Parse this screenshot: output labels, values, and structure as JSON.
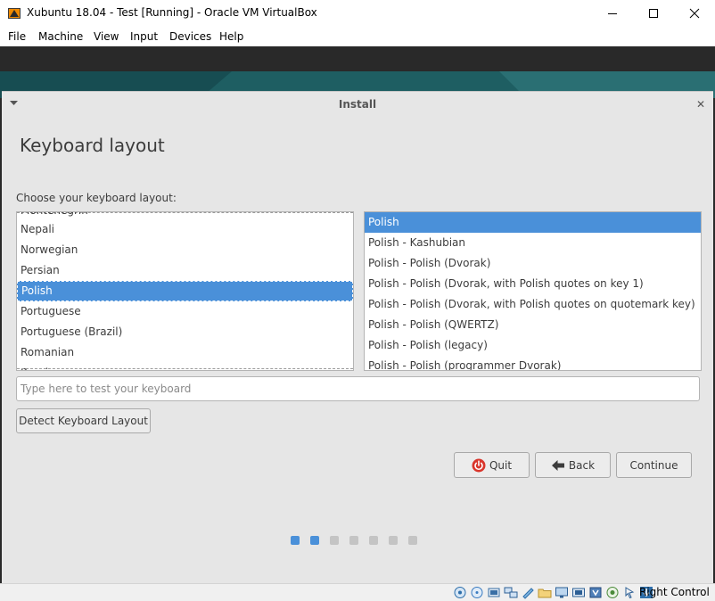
{
  "window": {
    "title": "Xubuntu 18.04 - Test [Running] - Oracle VM VirtualBox",
    "icon": "virtualbox-app-icon",
    "controls": [
      "minimize-icon",
      "maximize-icon",
      "close-icon"
    ]
  },
  "menubar": {
    "items": [
      "File",
      "Machine",
      "View",
      "Input",
      "Devices",
      "Help"
    ]
  },
  "installer": {
    "window_title": "Install",
    "close_glyph": "✕",
    "heading": "Keyboard layout",
    "choose_label": "Choose your keyboard layout:",
    "layouts": [
      "Montenegrin",
      "Nepali",
      "Norwegian",
      "Persian",
      "Polish",
      "Portuguese",
      "Portuguese (Brazil)",
      "Romanian",
      "Russian"
    ],
    "selected_layout": "Polish",
    "variants": [
      "Polish",
      "Polish - Kashubian",
      "Polish - Polish (Dvorak)",
      "Polish - Polish (Dvorak, with Polish quotes on key 1)",
      "Polish - Polish (Dvorak, with Polish quotes on quotemark key)",
      "Polish - Polish (QWERTZ)",
      "Polish - Polish (legacy)",
      "Polish - Polish (programmer Dvorak)"
    ],
    "selected_variant": "Polish",
    "test_placeholder": "Type here to test your keyboard",
    "test_value": "",
    "detect_button": "Detect Keyboard Layout",
    "quit_button": "Quit",
    "back_button": "Back",
    "continue_button": "Continue",
    "progress": {
      "total_steps": 7,
      "completed_steps": 2
    }
  },
  "statusbar": {
    "icons": [
      "hard-disk-icon",
      "optical-drive-icon",
      "audio-icon",
      "network-icon",
      "usb-icon",
      "shared-folders-icon",
      "display-icon",
      "video-capture-icon",
      "cpu-icon",
      "recording-icon",
      "mouse-integration-icon",
      "keyboard-capture-icon"
    ],
    "host_key": "Right Control"
  },
  "colors": {
    "selection": "#4a90d9",
    "dialog_bg": "#e6e6e6",
    "quit_red": "#d9352b"
  }
}
